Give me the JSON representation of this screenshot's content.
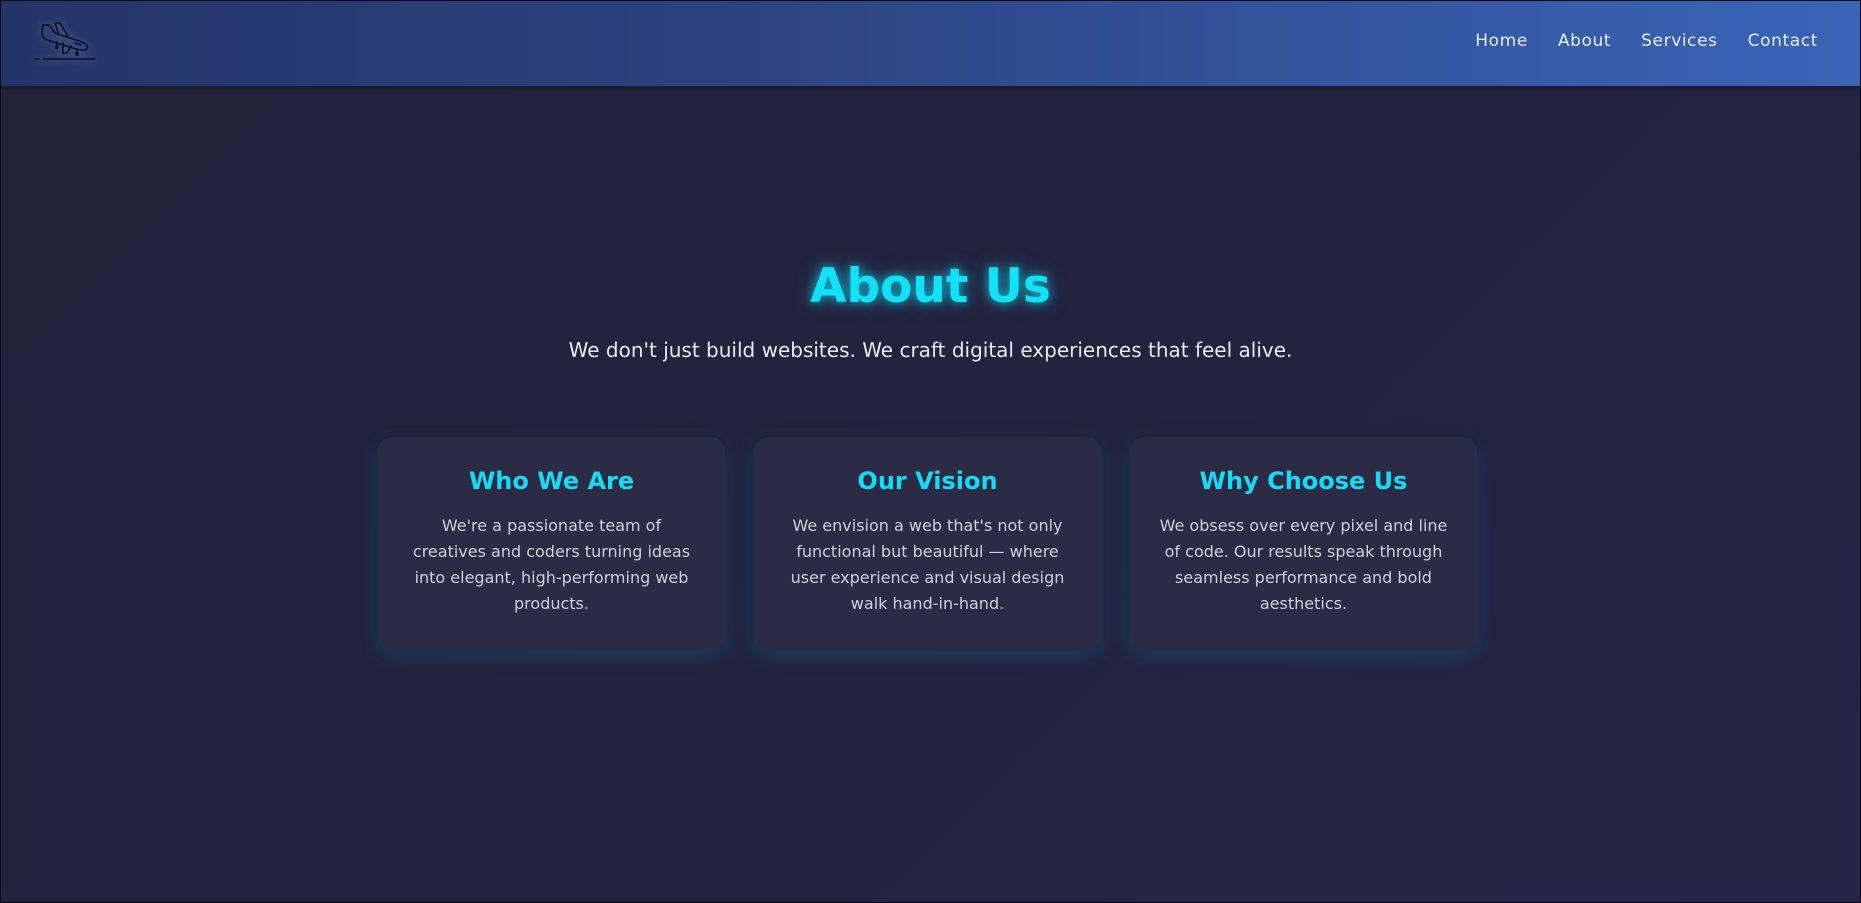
{
  "header": {
    "logo_icon": "airplane-landing-icon",
    "nav": [
      {
        "label": "Home"
      },
      {
        "label": "About"
      },
      {
        "label": "Services"
      },
      {
        "label": "Contact"
      }
    ]
  },
  "hero": {
    "title": "About Us",
    "subtitle": "We don't just build websites. We craft digital experiences that feel alive."
  },
  "cards": [
    {
      "title": "Who We Are",
      "text": "We're a passionate team of creatives and coders turning ideas into elegant, high-performing web products."
    },
    {
      "title": "Our Vision",
      "text": "We envision a web that's not only functional but beautiful — where user experience and visual design walk hand-in-hand."
    },
    {
      "title": "Why Choose Us",
      "text": "We obsess over every pixel and line of code. Our results speak through seamless performance and bold aesthetics."
    }
  ],
  "colors": {
    "accent": "#12e2f8",
    "header_start": "#233468",
    "header_end": "#3a64b8",
    "background": "#22223a",
    "card": "#2b2b45"
  }
}
